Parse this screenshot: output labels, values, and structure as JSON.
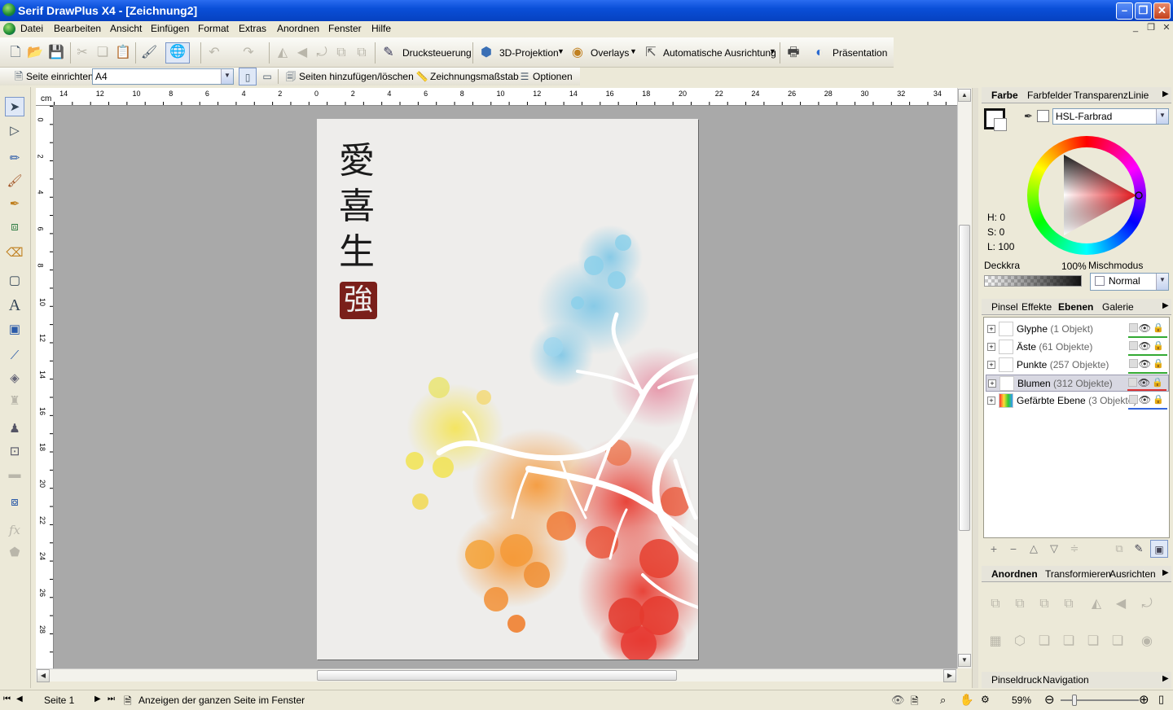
{
  "window": {
    "title": "Serif DrawPlus X4 - [Zeichnung2]"
  },
  "menu": [
    "Datei",
    "Bearbeiten",
    "Ansicht",
    "Einfügen",
    "Format",
    "Extras",
    "Anordnen",
    "Fenster",
    "Hilfe"
  ],
  "toolbar": {
    "drucksteuerung": "Drucksteuerung",
    "projektion": "3D-Projektion",
    "overlays": "Overlays",
    "ausrichtung": "Automatische Ausrichtung",
    "praesentation": "Präsentation"
  },
  "pagebar": {
    "setup": "Seite einrichten",
    "size": "A4",
    "addpages": "Seiten hinzufügen/löschen",
    "scale": "Zeichnungsmaßstab",
    "options": "Optionen"
  },
  "ruler": {
    "unit": "cm",
    "top": [
      "14",
      "12",
      "10",
      "8",
      "6",
      "4",
      "2",
      "0",
      "2",
      "4",
      "6",
      "8",
      "10",
      "12",
      "14",
      "16",
      "18",
      "20",
      "22",
      "24",
      "26",
      "28",
      "30",
      "32",
      "34"
    ],
    "left": [
      "0",
      "2",
      "4",
      "6",
      "8",
      "10",
      "12",
      "14",
      "16",
      "18",
      "20",
      "22",
      "24",
      "26",
      "28"
    ]
  },
  "artwork": {
    "glyphs": [
      "愛",
      "喜",
      "生"
    ],
    "seal": "強"
  },
  "color_panel": {
    "tabs": [
      "Farbe",
      "Farbfelder",
      "Transparenz",
      "Linie"
    ],
    "model": "HSL-Farbrad",
    "h": "H: 0",
    "s": "S: 0",
    "l": "L: 100",
    "opacity_label": "Deckkra",
    "opacity_value": "100%",
    "blend_label": "Mischmodus",
    "blend_value": "Normal"
  },
  "layers_panel": {
    "tabs": [
      "Pinsel",
      "Effekte",
      "Ebenen",
      "Galerie"
    ],
    "layers": [
      {
        "name": "Glyphe",
        "count": "(1 Objekt)",
        "color": "#33aa33"
      },
      {
        "name": "Äste",
        "count": "(61 Objekte)",
        "color": "#33aa33"
      },
      {
        "name": "Punkte",
        "count": "(257 Objekte)",
        "color": "#33aa33"
      },
      {
        "name": "Blumen",
        "count": "(312 Objekte)",
        "color": "#dd3333"
      },
      {
        "name": "Gefärbte Ebene",
        "count": "(3 Objekte)",
        "color": "#3366dd"
      }
    ]
  },
  "arrange_panel": {
    "tabs": [
      "Anordnen",
      "Transformieren",
      "Ausrichten"
    ]
  },
  "bottom_panel": {
    "tabs": [
      "Pinseldruck",
      "Navigation"
    ]
  },
  "status": {
    "page": "Seite 1",
    "hint": "Anzeigen der ganzen Seite im Fenster",
    "zoom": "59%"
  }
}
